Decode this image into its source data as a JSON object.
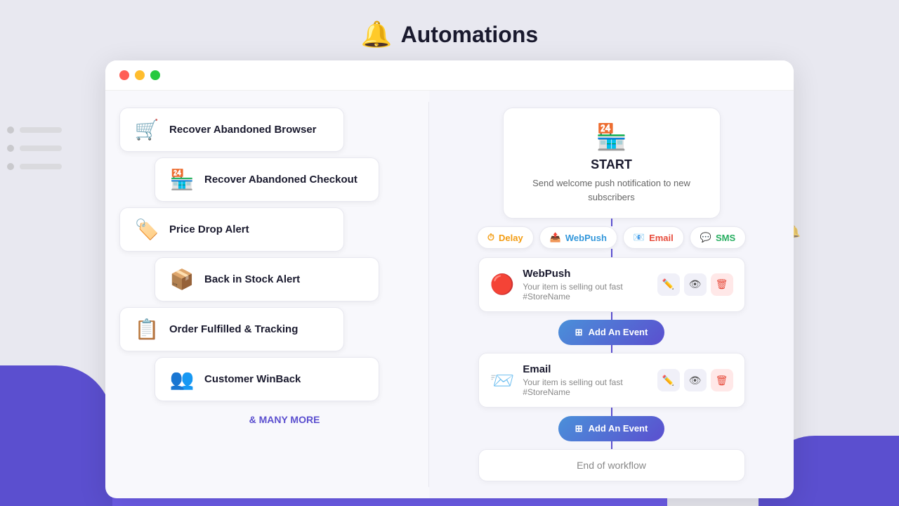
{
  "header": {
    "title": "Automations",
    "bell_icon": "🔔"
  },
  "window": {
    "traffic_lights": {
      "red": "#ff5f56",
      "yellow": "#ffbd2e",
      "green": "#27c93f"
    }
  },
  "left_panel": {
    "cards": [
      {
        "id": "recover-browser",
        "label": "Recover Abandoned Browser",
        "icon": "🛒",
        "offset": "left"
      },
      {
        "id": "recover-checkout",
        "label": "Recover Abandoned Checkout",
        "icon": "🏪",
        "offset": "right"
      },
      {
        "id": "price-drop",
        "label": "Price Drop Alert",
        "icon": "🏷️",
        "offset": "left"
      },
      {
        "id": "back-in-stock",
        "label": "Back in Stock Alert",
        "icon": "📦",
        "offset": "right"
      },
      {
        "id": "order-fulfilled",
        "label": "Order Fulfilled & Tracking",
        "icon": "📋",
        "offset": "left"
      },
      {
        "id": "customer-winback",
        "label": "Customer WinBack",
        "icon": "👥",
        "offset": "right"
      }
    ],
    "many_more": "& MANY MORE"
  },
  "right_panel": {
    "start_card": {
      "icon": "🏪",
      "label": "START",
      "description": "Send welcome push notification to new subscribers"
    },
    "action_buttons": [
      {
        "id": "delay",
        "label": "Delay",
        "icon": "⏱"
      },
      {
        "id": "webpush",
        "label": "WebPush",
        "icon": "📤"
      },
      {
        "id": "email",
        "label": "Email",
        "icon": "📧"
      },
      {
        "id": "sms",
        "label": "SMS",
        "icon": "💬"
      }
    ],
    "event_cards": [
      {
        "id": "webpush-event",
        "type": "WebPush",
        "icon": "🔴",
        "description": "Your item is selling out fast #StoreName"
      },
      {
        "id": "email-event",
        "type": "Email",
        "icon": "📨",
        "description": "Your item is selling out fast #StoreName"
      }
    ],
    "add_event_label": "Add An Event",
    "end_workflow_label": "End of workflow"
  }
}
